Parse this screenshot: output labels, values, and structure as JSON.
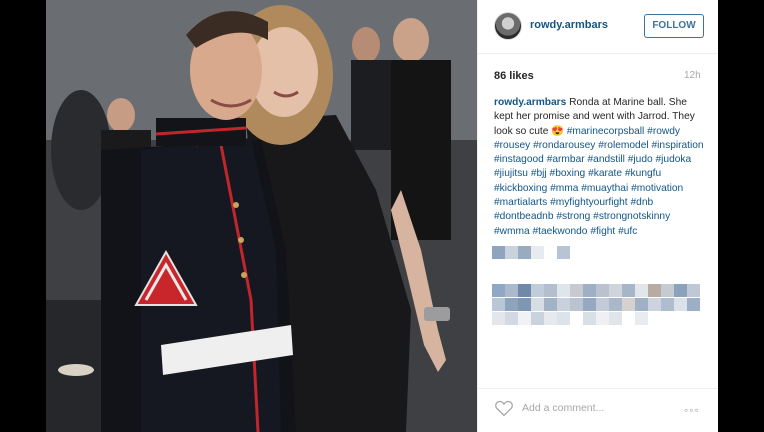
{
  "post": {
    "username": "rowdy.armbars",
    "follow_label": "FOLLOW",
    "likes": "86 likes",
    "time": "12h",
    "caption_user": "rowdy.armbars",
    "caption_text": "Ronda at Marine ball. She kept her promise and went with Jarrod. They look so cute 😍",
    "hashtags": [
      "#marinecorpsball",
      "#rowdy",
      "#rousey",
      "#rondarousey",
      "#rolemodel",
      "#inspiration",
      "#instagood",
      "#armbar",
      "#andstill",
      "#judo",
      "#judoka",
      "#jiujitsu",
      "#bjj",
      "#boxing",
      "#karate",
      "#kungfu",
      "#kickboxing",
      "#mma",
      "#muaythai",
      "#motivation",
      "#martialarts",
      "#myfightyourfight",
      "#dnb",
      "#dontbeadnb",
      "#strong",
      "#strongnotskinny",
      "#wmma",
      "#taekwondo",
      "#fight",
      "#ufc"
    ],
    "comment_placeholder": "Add a comment...",
    "more_glyph": "◦◦◦"
  },
  "colors": {
    "link": "#125688",
    "follow_border": "#3f729b",
    "muted": "#a5a7aa"
  },
  "icons": {
    "avatar": "avatar-icon",
    "like": "heart-icon",
    "more": "more-icon"
  }
}
